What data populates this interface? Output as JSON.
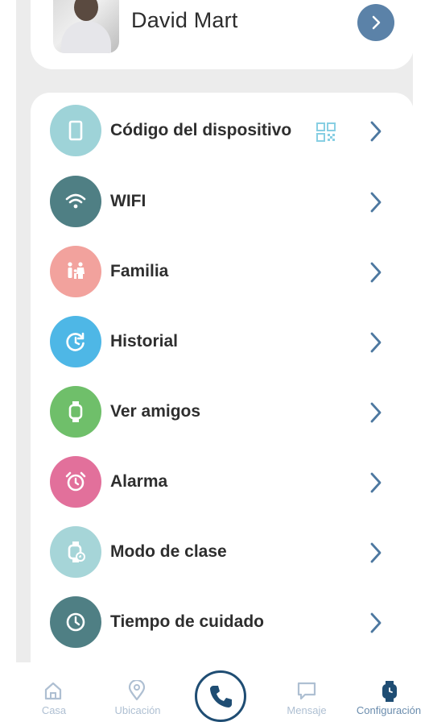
{
  "profile": {
    "name": "David Mart"
  },
  "menu": [
    {
      "label": "Código del dispositivo",
      "icon": "phone-icon",
      "color": "#9ed3d8",
      "has_qr": true
    },
    {
      "label": "WIFI",
      "icon": "wifi-icon",
      "color": "#4f7f84"
    },
    {
      "label": "Familia",
      "icon": "family-icon",
      "color": "#f2a29d"
    },
    {
      "label": "Historial",
      "icon": "history-icon",
      "color": "#4eb7e6"
    },
    {
      "label": "Ver amigos",
      "icon": "watch-icon",
      "color": "#6fbf6a"
    },
    {
      "label": "Alarma",
      "icon": "alarm-icon",
      "color": "#e2709b"
    },
    {
      "label": "Modo de clase",
      "icon": "class-mode-icon",
      "color": "#a6d5d8"
    },
    {
      "label": "Tiempo de cuidado",
      "icon": "clock-icon",
      "color": "#4f7f84"
    }
  ],
  "nav": [
    {
      "label": "Casa",
      "icon": "home-icon"
    },
    {
      "label": "Ubicación",
      "icon": "location-pin-icon"
    },
    {
      "label": "",
      "icon": "phone-call-icon"
    },
    {
      "label": "Mensaje",
      "icon": "message-icon"
    },
    {
      "label": "Configuración",
      "icon": "watch-settings-icon",
      "active": true
    }
  ],
  "colors": {
    "accent": "#5b82a8",
    "chevron": "#4d78a0",
    "nav_inactive": "#aebfd2",
    "nav_active": "#6a8cad",
    "call_ring": "#1f4d73"
  }
}
